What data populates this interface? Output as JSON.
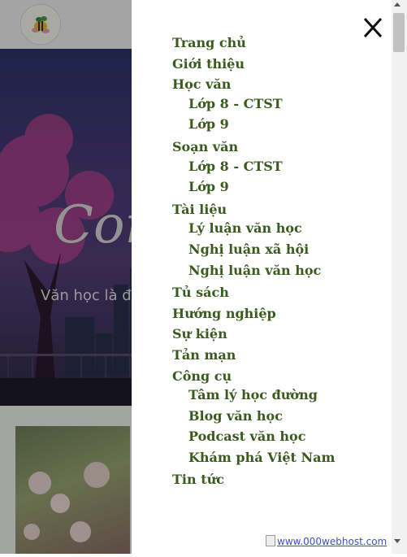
{
  "menu": {
    "items": [
      {
        "label": "Trang chủ",
        "level": 0
      },
      {
        "label": "Giới thiệu",
        "level": 0
      },
      {
        "label": "Học văn",
        "level": 0
      },
      {
        "label": "Lớp 8 - CTST",
        "level": 1
      },
      {
        "label": "Lớp 9",
        "level": 1
      },
      {
        "label": "Soạn văn",
        "level": 0
      },
      {
        "label": "Lớp 8 - CTST",
        "level": 1
      },
      {
        "label": "Lớp 9",
        "level": 1
      },
      {
        "label": "Tài liệu",
        "level": 0
      },
      {
        "label": "Lý luận văn học",
        "level": 1
      },
      {
        "label": "Nghị luận xã hội",
        "level": 1
      },
      {
        "label": "Nghị luận văn học",
        "level": 1
      },
      {
        "label": "Tủ sách",
        "level": 0
      },
      {
        "label": "Hướng nghiệp",
        "level": 0
      },
      {
        "label": "Sự kiện",
        "level": 0
      },
      {
        "label": "Tản mạn",
        "level": 0
      },
      {
        "label": "Công cụ",
        "level": 0
      },
      {
        "label": "Tâm lý học đường",
        "level": 1
      },
      {
        "label": "Blog văn học",
        "level": 1
      },
      {
        "label": "Podcast văn học",
        "level": 1
      },
      {
        "label": "Khám phá Việt Nam",
        "level": 1
      },
      {
        "label": "Tin tức",
        "level": 0
      }
    ],
    "close_icon": "close-icon"
  },
  "hero": {
    "title_visible": "Con",
    "subtitle_visible": "Văn học là để"
  },
  "footer_link": "www.000webhost.com",
  "colors": {
    "menu_text": "#3a5a1e",
    "panel_bg": "#ffffff",
    "overlay": "rgba(0,0,0,0.32)",
    "link": "#3b54b3"
  }
}
